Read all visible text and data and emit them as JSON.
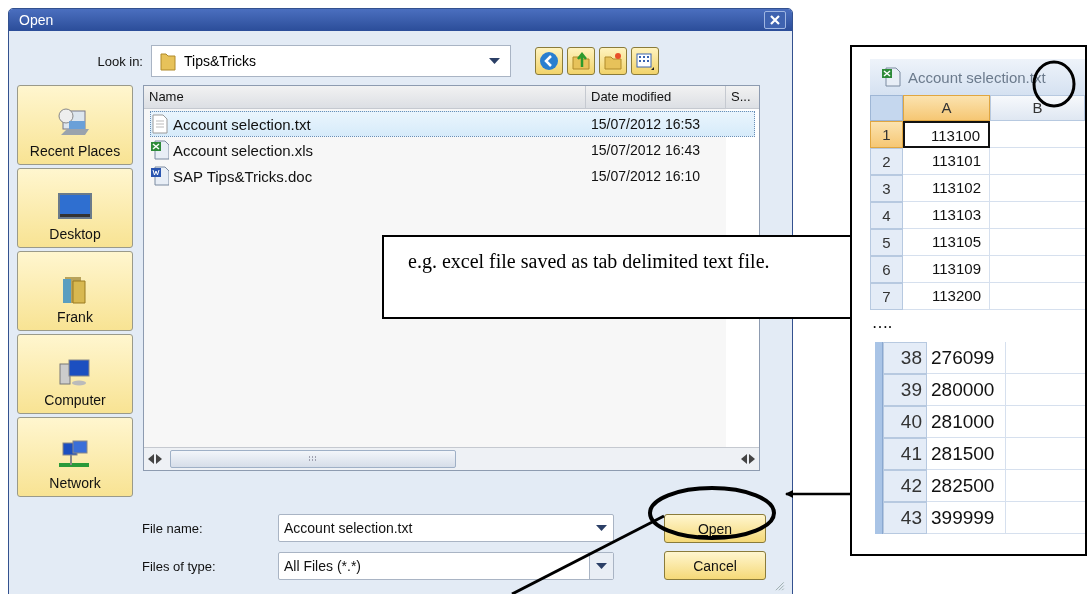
{
  "dialog": {
    "title": "Open",
    "look_in": {
      "label": "Look in:",
      "value": "Tips&Tricks"
    },
    "places": [
      {
        "label": "Recent Places",
        "kind": "recent"
      },
      {
        "label": "Desktop",
        "kind": "desktop"
      },
      {
        "label": "Frank",
        "kind": "user"
      },
      {
        "label": "Computer",
        "kind": "computer"
      },
      {
        "label": "Network",
        "kind": "network"
      }
    ],
    "file_list": {
      "columns": [
        "Name",
        "Date modified",
        "S..."
      ],
      "rows": [
        {
          "name": "Account selection.txt",
          "date": "15/07/2012 16:53",
          "kind": "txt",
          "selected": true
        },
        {
          "name": "Account selection.xls",
          "date": "15/07/2012 16:43",
          "kind": "xls",
          "selected": false
        },
        {
          "name": "SAP Tips&Tricks.doc",
          "date": "15/07/2012 16:10",
          "kind": "doc",
          "selected": false
        }
      ]
    },
    "file_name": {
      "label": "File name:",
      "value": "Account selection.txt"
    },
    "file_type": {
      "label": "Files of type:",
      "value": "All Files (*.*)"
    },
    "buttons": [
      {
        "label": "Open",
        "kind": "default"
      },
      {
        "label": "Cancel",
        "kind": "normal"
      }
    ]
  },
  "callout": {
    "text": "e.g. excel file saved as tab delimited text file."
  },
  "spreadsheet": {
    "title": "Account selection.txt",
    "columns": [
      "A",
      "B"
    ],
    "rows": [
      {
        "row": "1",
        "value": "113100",
        "selected": true
      },
      {
        "row": "2",
        "value": "113101",
        "selected": false
      },
      {
        "row": "3",
        "value": "113102",
        "selected": false
      },
      {
        "row": "4",
        "value": "113103",
        "selected": false
      },
      {
        "row": "5",
        "value": "113105",
        "selected": false
      },
      {
        "row": "6",
        "value": "113109",
        "selected": false
      },
      {
        "row": "7",
        "value": "113200",
        "selected": false
      }
    ],
    "ellipsis": "….",
    "rows_continued": [
      {
        "row": "38",
        "value": "276099"
      },
      {
        "row": "39",
        "value": "280000"
      },
      {
        "row": "40",
        "value": "281000"
      },
      {
        "row": "41",
        "value": "281500"
      },
      {
        "row": "42",
        "value": "282500"
      },
      {
        "row": "43",
        "value": "399999"
      }
    ]
  }
}
